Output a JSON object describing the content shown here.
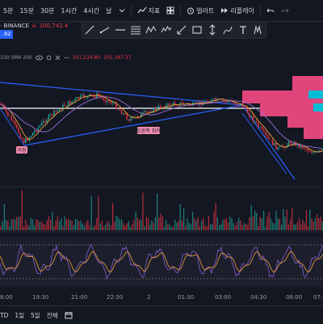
{
  "toolbar": {
    "timeframes": [
      "5분",
      "15분",
      "30분",
      "1시간",
      "4시간",
      "날"
    ],
    "dropdown_icon": "chevron-down-icon",
    "indicators_label": "지표",
    "layouts_icon": "grid-icon",
    "alert_label": "얼러트",
    "replay_label": "리플레이",
    "undo_icon": "undo-icon",
    "redo_icon": "redo-icon"
  },
  "symbol": {
    "name": "· BINANCE",
    "ohlc_prefix": "A",
    "ohlc_value": "100,742.4",
    "price_badge": ".82"
  },
  "indicator_row": {
    "text": "100 SMA 200",
    "value1": "101,234.80",
    "value2": "101,347.37"
  },
  "chart_labels": {
    "low_label": "저점",
    "mid_label": "오른쪽 최저"
  },
  "time_axis": [
    "8:00",
    "19:30",
    "21:00",
    "22:30",
    "2",
    "01:30",
    "03:00",
    "04:30",
    "06:00",
    "07:"
  ],
  "bottom": {
    "items": [
      "TD",
      "1일",
      "5일",
      "전체"
    ]
  },
  "colors": {
    "background": "#131722",
    "bull": "#26a69a",
    "bear": "#f23645",
    "trendline": "#2962ff",
    "oscillator": "#7e57c2",
    "volume_profile": "#e0457b",
    "volume_profile_accent": "#00bcd4"
  }
}
